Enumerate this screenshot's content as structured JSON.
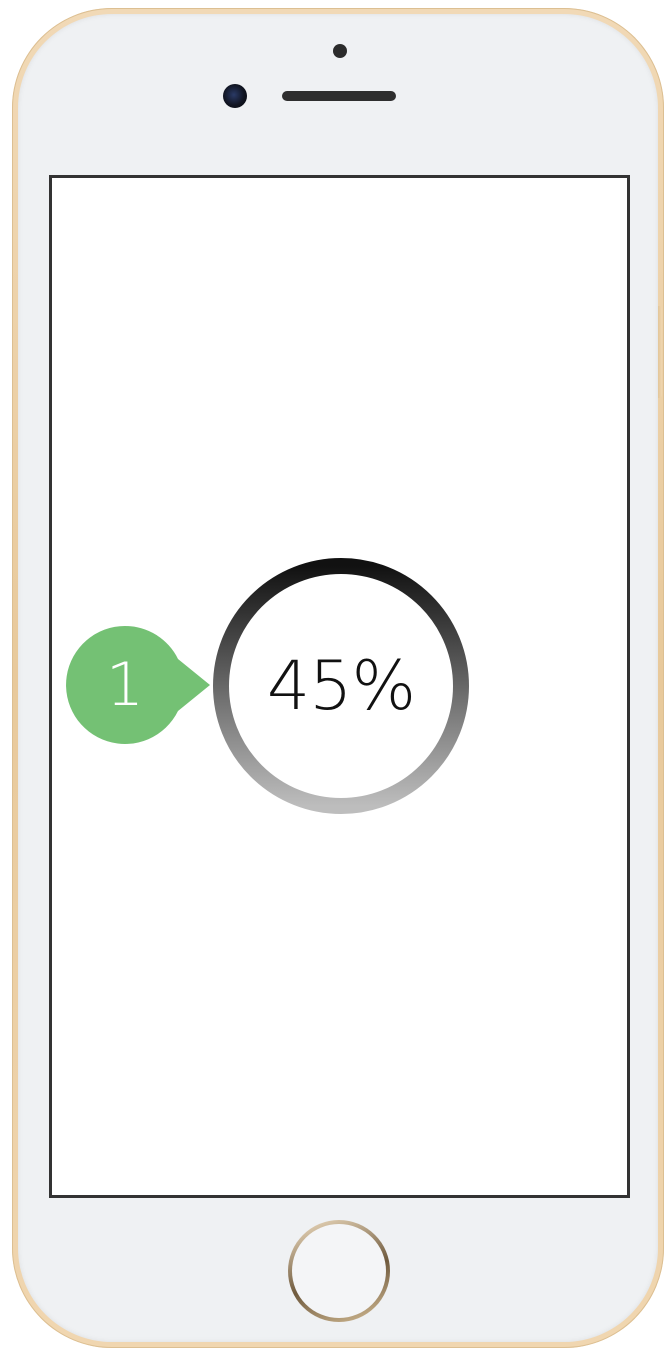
{
  "device": {
    "body_color": "#ecd0a6",
    "face_color": "#eff1f3",
    "screen_border_color": "#333333"
  },
  "progress": {
    "value_percent": 45,
    "label": "45%",
    "ring_gradient_start": "#111111",
    "ring_gradient_end": "#bdbdbd"
  },
  "callout": {
    "number": "1",
    "color": "#74c174"
  },
  "icons": {
    "home": "home-button-icon",
    "camera": "front-camera-icon",
    "speaker": "earpiece-speaker-icon",
    "sensor": "proximity-sensor-icon"
  }
}
